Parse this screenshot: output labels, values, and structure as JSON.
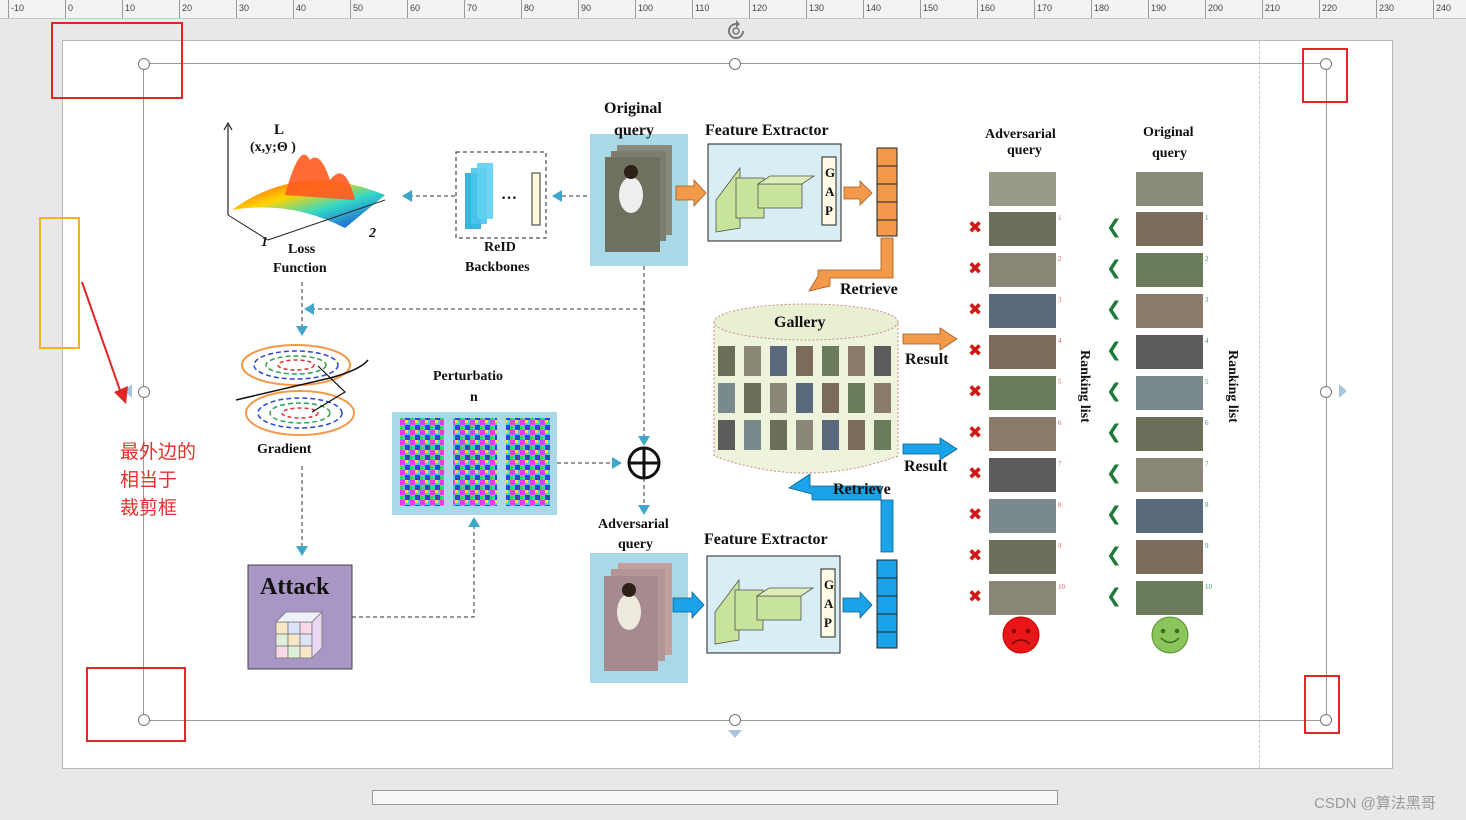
{
  "ruler": {
    "labels": [
      "-10",
      "0",
      "10",
      "20",
      "30",
      "40",
      "50",
      "60",
      "70",
      "80",
      "90",
      "100",
      "110",
      "120",
      "130",
      "140",
      "150",
      "160",
      "170",
      "180",
      "190",
      "200",
      "210",
      "220",
      "230",
      "240"
    ]
  },
  "annotation": {
    "line1": "最外边的",
    "line2": "相当于",
    "line3": "裁剪框",
    "color": "#e5302b"
  },
  "figure": {
    "loss": {
      "l_label": "L",
      "l_args": "(x,y;Θ )",
      "axis_1": "1",
      "axis_2": "2",
      "caption1": "Loss",
      "caption2": "Function"
    },
    "backbone": {
      "dots": "…",
      "caption1": "ReID",
      "caption2": "Backbones"
    },
    "original_query": {
      "line1": "Original",
      "line2": "query"
    },
    "feature_extractor_top": {
      "title": "Feature Extractor",
      "gap": [
        "G",
        "A",
        "P"
      ]
    },
    "retrieve_top": "Retrieve",
    "gallery": {
      "title": "Gallery"
    },
    "result_top": "Result",
    "result_bottom": "Result",
    "retrieve_bottom": "Retrieve",
    "gradient": {
      "caption": "Gradient"
    },
    "perturbation": {
      "line1": "Perturbatio",
      "line2": "n"
    },
    "adversarial_query": {
      "line1": "Adversarial",
      "line2": "query"
    },
    "feature_extractor_bottom": {
      "title": "Feature Extractor",
      "gap": [
        "G",
        "A",
        "P"
      ]
    },
    "attack": {
      "label": "Attack"
    },
    "adv_ranking": {
      "header1": "Adversarial",
      "header2": "query",
      "side": "Ranking list",
      "mark": "✖",
      "face": "☹",
      "numbers": [
        "1",
        "2",
        "3",
        "4",
        "5",
        "6",
        "7",
        "8",
        "9",
        "10"
      ]
    },
    "orig_ranking": {
      "header1": "Original",
      "header2": "query",
      "side": "Ranking list",
      "mark": "❮",
      "face": "☺",
      "numbers": [
        "1",
        "2",
        "3",
        "4",
        "5",
        "6",
        "7",
        "8",
        "9",
        "10"
      ]
    },
    "colors": {
      "orange": "#f39a4a",
      "blue": "#1aa3e8",
      "cyan_bg": "#a9d8e6",
      "red_x": "#d01a1a",
      "green_check": "#1f7a3a"
    }
  },
  "footer": {
    "watermark": "CSDN @算法黑哥"
  }
}
